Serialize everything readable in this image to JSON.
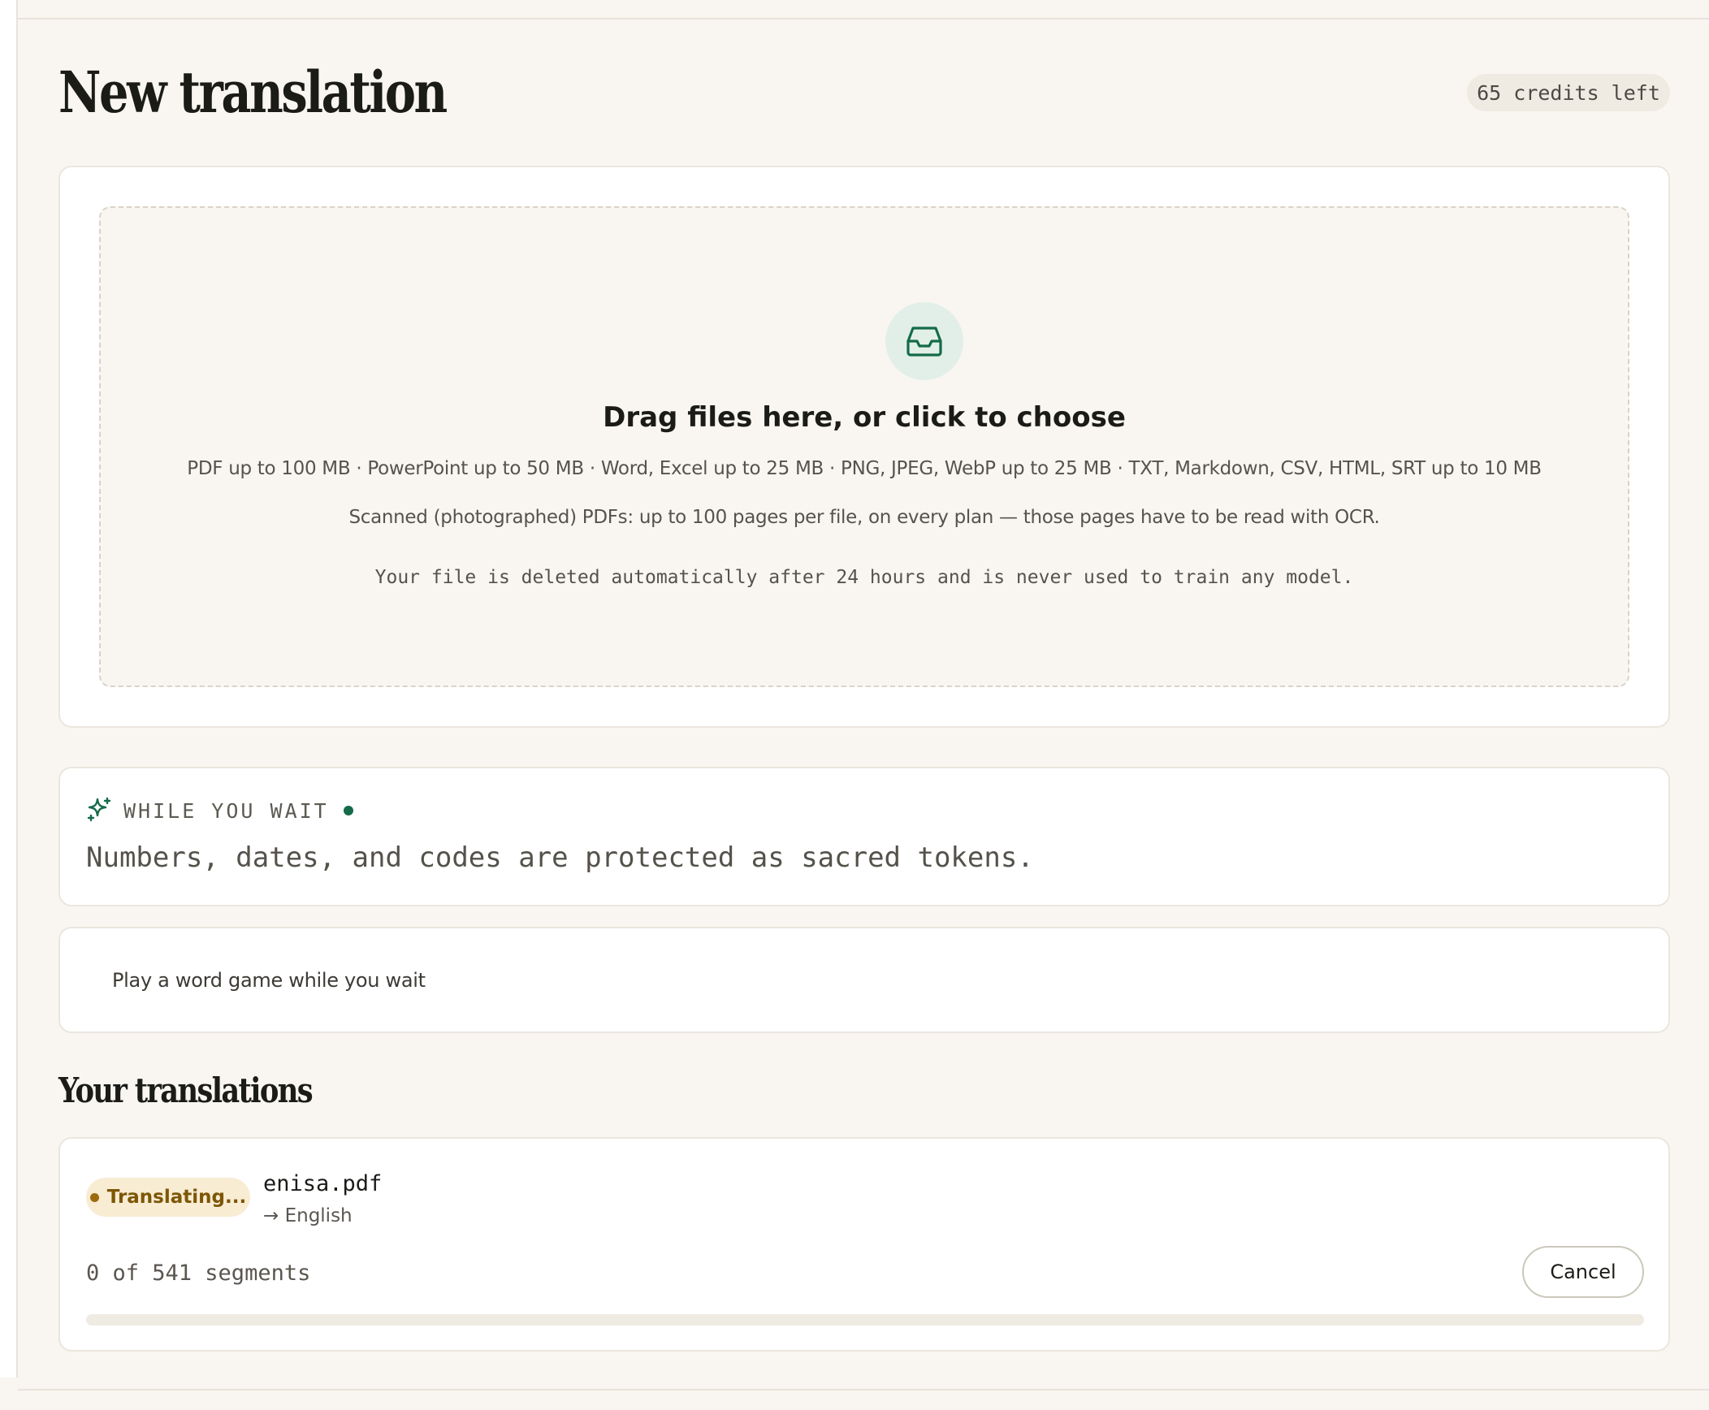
{
  "header": {
    "title": "New translation",
    "credits": "65 credits left"
  },
  "upload": {
    "icon": "inbox-icon",
    "title": "Drag files here, or click to choose",
    "limits": "PDF up to 100 MB · PowerPoint up to 50 MB · Word, Excel up to 25 MB · PNG, JPEG, WebP up to 25 MB · TXT, Markdown, CSV, HTML, SRT up to 10 MB",
    "scanned_note": "Scanned (photographed) PDFs: up to 100 pages per file, on every plan — those pages have to be read with OCR.",
    "privacy_note": "Your file is deleted automatically after 24 hours and is never used to train any model."
  },
  "while_you_wait": {
    "icon": "sparkle-icon",
    "label": "WHILE YOU WAIT",
    "tip": "Numbers, dates, and codes are protected as sacred tokens."
  },
  "word_game": {
    "label": "Play a word game while you wait"
  },
  "translations": {
    "title": "Your translations",
    "items": [
      {
        "status": "Translating...",
        "file_name": "enisa.pdf",
        "target": "→ English",
        "progress_text": "0 of 541 segments",
        "progress_fraction": 0,
        "cancel_label": "Cancel"
      }
    ]
  },
  "colors": {
    "accent": "#146b49",
    "status_bg": "#f8ecd3",
    "status_text": "#7d5606",
    "background": "#f9f6f1"
  }
}
